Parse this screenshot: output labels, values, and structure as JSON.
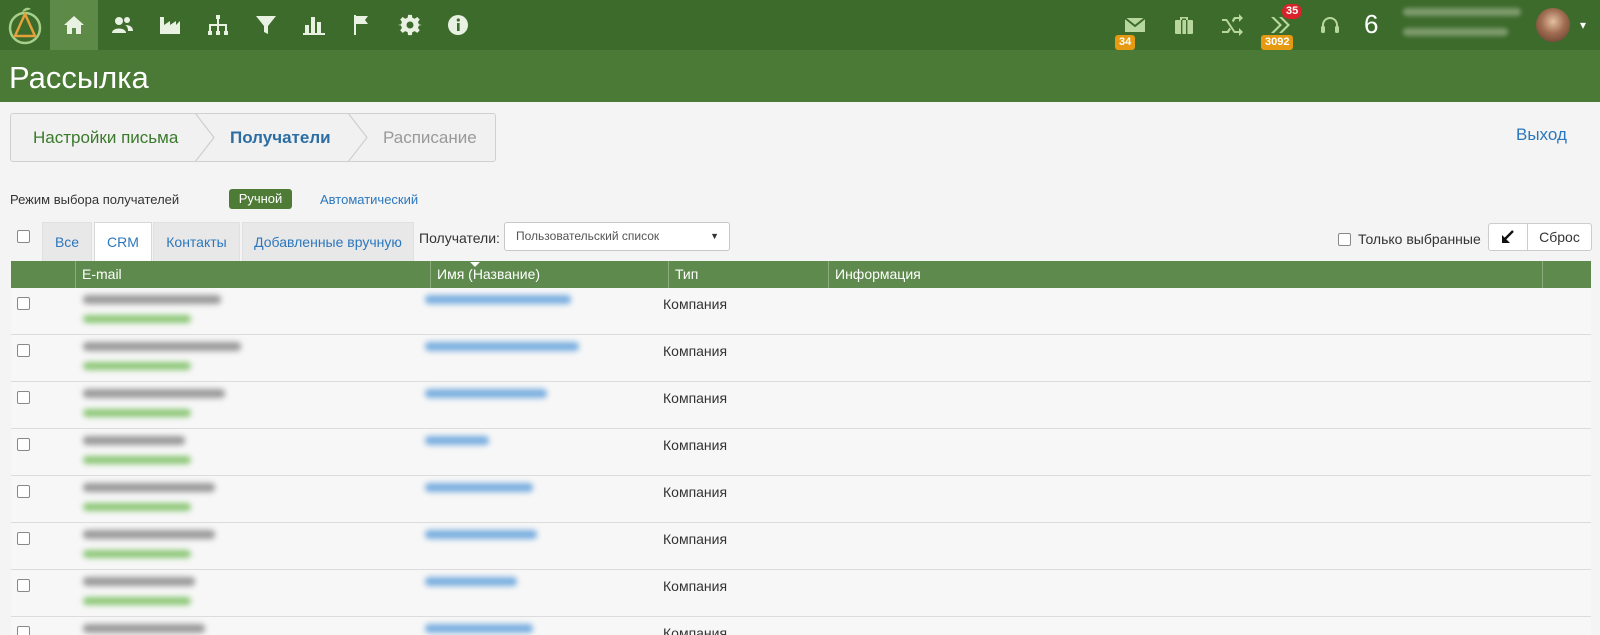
{
  "nav": {
    "icons": [
      "home-icon",
      "contacts-icon",
      "factory-icon",
      "structure-icon",
      "filter-icon",
      "chart-icon",
      "flag-icon",
      "gear-icon",
      "info-icon"
    ]
  },
  "toolbar": {
    "mail_badge": "34",
    "tasks_badge": "35",
    "tasks_badge2": "3092",
    "counter": "6"
  },
  "page": {
    "title": "Рассылка"
  },
  "wizard": {
    "steps": [
      "Настройки письма",
      "Получатели",
      "Расписание"
    ],
    "exit": "Выход"
  },
  "mode": {
    "label": "Режим выбора получателей",
    "manual": "Ручной",
    "auto": "Автоматический"
  },
  "tabs": [
    "Все",
    "CRM",
    "Контакты",
    "Добавленные вручную"
  ],
  "recipients": {
    "label": "Получатели:",
    "selected": "Пользовательский список"
  },
  "filters": {
    "only_selected": "Только выбранные",
    "reset": "Сброс"
  },
  "table": {
    "headers": [
      "E-mail",
      "Имя (Название)",
      "Тип",
      "Информация"
    ],
    "rows": [
      {
        "type": "Компания"
      },
      {
        "type": "Компания"
      },
      {
        "type": "Компания"
      },
      {
        "type": "Компания"
      },
      {
        "type": "Компания"
      },
      {
        "type": "Компания"
      },
      {
        "type": "Компания"
      },
      {
        "type": "Компания"
      }
    ]
  },
  "colors": {
    "topbar": "#3d6b2c",
    "titlebar": "#4a7a35",
    "header": "#5e8a4d",
    "link": "#2c77bd"
  }
}
